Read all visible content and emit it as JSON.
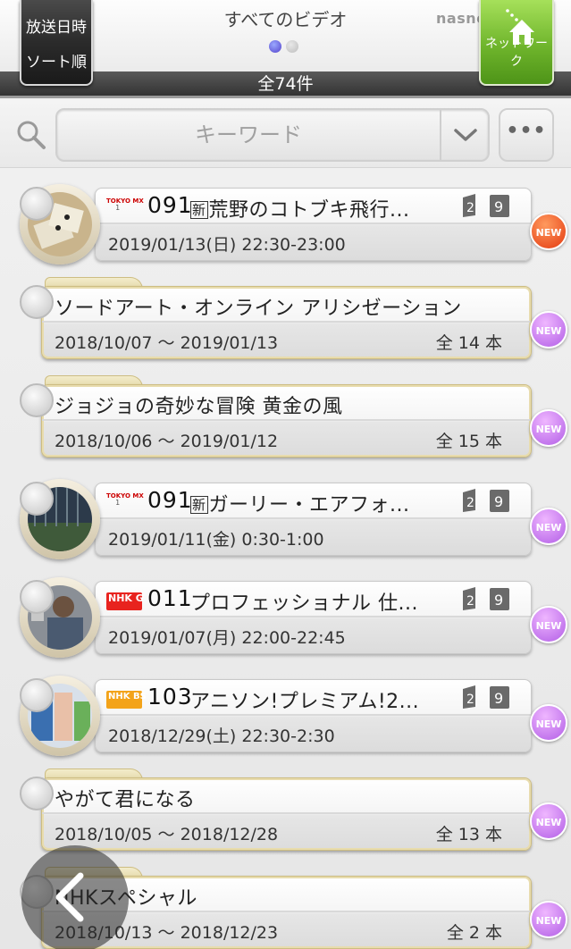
{
  "header": {
    "sort_line1": "放送日時",
    "sort_line2": "ソート順",
    "title": "すべてのビデオ",
    "brand": "nasne",
    "network_label": "ネットワーク",
    "total_count": "全74件"
  },
  "search": {
    "placeholder": "キーワード",
    "more_label": "•••"
  },
  "items": [
    {
      "type": "program",
      "channel": "TOKYO MX 1",
      "channel_number": "091",
      "new": true,
      "title": "荒野のコトブキ飛行...",
      "datetime": "2019/01/13(日) 22:30-23:00",
      "badge": "NEW",
      "badge_color": "red"
    },
    {
      "type": "folder",
      "title": "ソードアート・オンライン アリシゼーション",
      "range": "2018/10/07 ～ 2019/01/13",
      "count": "全 14 本",
      "badge": "NEW",
      "badge_color": "purple"
    },
    {
      "type": "folder",
      "title": "ジョジョの奇妙な冒険 黄金の風",
      "range": "2018/10/06 ～ 2019/01/12",
      "count": "全 15 本",
      "badge": "NEW",
      "badge_color": "purple"
    },
    {
      "type": "program",
      "channel": "TOKYO MX 1",
      "channel_number": "091",
      "new": true,
      "title": "ガーリー・エアフォ...",
      "datetime": "2019/01/11(金) 0:30-1:00",
      "badge": "NEW",
      "badge_color": "purple"
    },
    {
      "type": "program",
      "channel": "NHK G",
      "channel_number": "011",
      "new": false,
      "title": "プロフェッショナル 仕...",
      "datetime": "2019/01/07(月) 22:00-22:45",
      "badge": "NEW",
      "badge_color": "purple"
    },
    {
      "type": "program",
      "channel": "NHK BS",
      "channel_number": "103",
      "new": false,
      "title": "アニソン!プレミアム!2...",
      "datetime": "2018/12/29(土) 22:30-2:30",
      "badge": "NEW",
      "badge_color": "purple"
    },
    {
      "type": "folder",
      "title": "やがて君になる",
      "range": "2018/10/05 ～ 2018/12/28",
      "count": "全 13 本",
      "badge": "NEW",
      "badge_color": "purple"
    },
    {
      "type": "folder",
      "title": "NHKスペシャル",
      "range": "2018/10/13 ～ 2018/12/23",
      "count": "全 2 本",
      "badge": "NEW",
      "badge_color": "purple"
    }
  ],
  "colors": {
    "accent_green": "#6fb52c",
    "badge_red": "#e43a10",
    "badge_purple": "#b25ee6"
  }
}
